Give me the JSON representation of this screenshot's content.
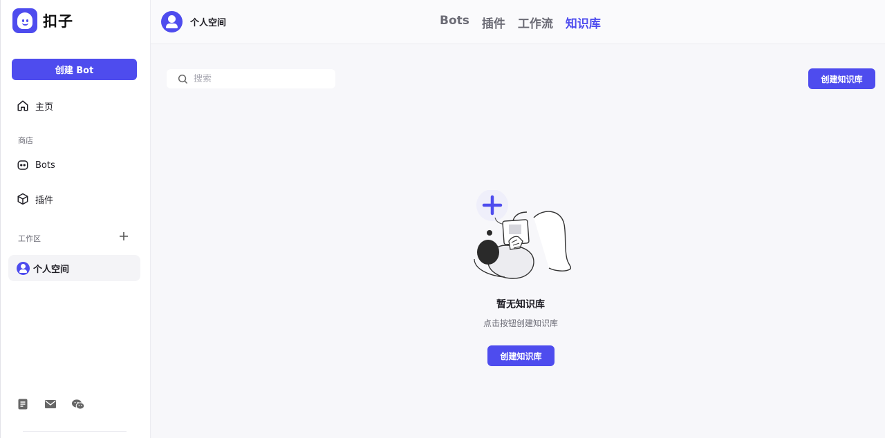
{
  "brand": {
    "name": "扣子",
    "logo_icon": "coze-logo-icon",
    "accent": "#4e4cee"
  },
  "sidebar": {
    "create_bot_label": "创建 Bot",
    "home_label": "主页",
    "store_section": "商店",
    "store_items": [
      {
        "label": "Bots",
        "icon": "bot-icon"
      },
      {
        "label": "插件",
        "icon": "cube-icon"
      }
    ],
    "workspace_section": "工作区",
    "workspace_item": "个人空间",
    "footer_icons": [
      "document-icon",
      "mail-icon",
      "wechat-icon"
    ]
  },
  "header": {
    "workspace_name": "个人空间",
    "tabs": [
      {
        "label": "Bots",
        "active": false
      },
      {
        "label": "插件",
        "active": false
      },
      {
        "label": "工作流",
        "active": false
      },
      {
        "label": "知识库",
        "active": true
      }
    ]
  },
  "main": {
    "search_placeholder": "搜索",
    "search_value": "",
    "create_button_label": "创建知识库",
    "empty": {
      "title": "暂无知识库",
      "description": "点击按钮创建知识库",
      "button_label": "创建知识库"
    }
  }
}
